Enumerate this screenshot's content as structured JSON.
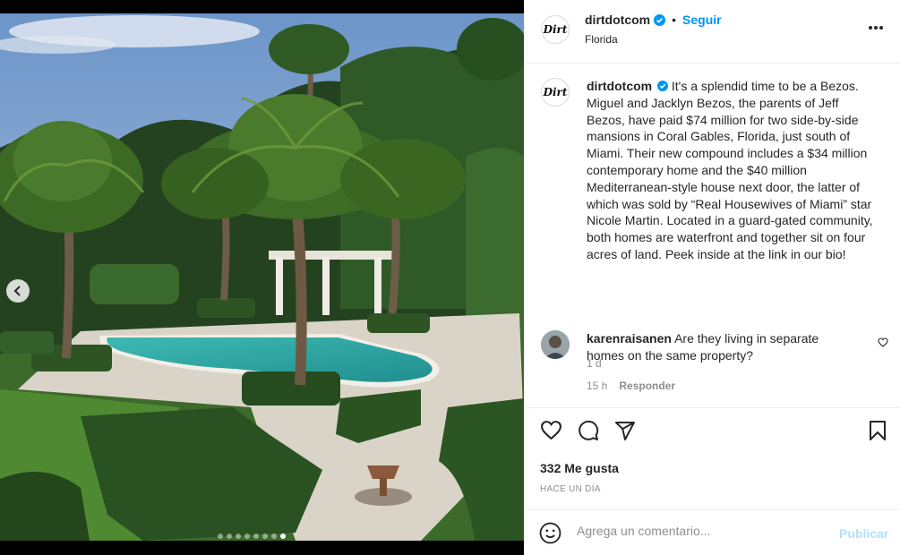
{
  "photo": {
    "alt": "Vista aérea de un jardín con palmeras y piscina",
    "carousel_dots": 8,
    "active_dot": 7
  },
  "header": {
    "avatar_text": "Dirt",
    "username": "dirtdotcom",
    "separator": "•",
    "follow_label": "Seguir",
    "location": "Florida"
  },
  "caption": {
    "username": "dirtdotcom",
    "text": "It's a splendid time to be a Bezos. Miguel and Jacklyn Bezos, the parents of Jeff Bezos, have paid $74 million for two side-by-side mansions in Coral Gables, Florida, just south of Miami. Their new compound includes a $34 million contemporary home and the $40 million Mediterranean-style house next door, the latter of which was sold by “Real Housewives of Miami” star Nicole Martin. Located in a guard-gated community, both homes are waterfront and together sit on four acres of land. Peek inside at the link in our bio!",
    "time": "1 d"
  },
  "comment": {
    "username": "karenraisanen",
    "text": "Are they living in separate homes on the same property?",
    "time": "15 h",
    "reply_label": "Responder"
  },
  "actions": {
    "likes": "332 Me gusta",
    "posted": "HACE UN DÍA"
  },
  "add_comment": {
    "placeholder": "Agrega un comentario...",
    "publish_label": "Publicar"
  },
  "colors": {
    "link_blue": "#0095f6",
    "publish_disabled": "#b2dffc",
    "muted": "#8e8e8e",
    "text": "#262626"
  }
}
